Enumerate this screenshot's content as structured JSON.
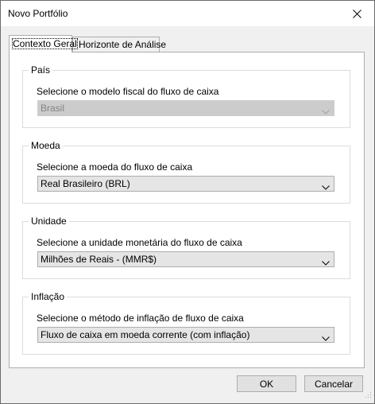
{
  "window": {
    "title": "Novo Portfólio",
    "close_icon": "close-icon"
  },
  "tabs": [
    {
      "label": "Contexto Geral",
      "active": true
    },
    {
      "label": "Horizonte de Análise",
      "active": false
    }
  ],
  "groups": {
    "pais": {
      "label": "País",
      "description": "Selecione o modelo fiscal do fluxo de caixa",
      "value": "Brasil",
      "enabled": false
    },
    "moeda": {
      "label": "Moeda",
      "description": "Selecione a moeda do fluxo de caixa",
      "value": "Real Brasileiro (BRL)",
      "enabled": true
    },
    "unidade": {
      "label": "Unidade",
      "description": "Selecione a unidade monetária do fluxo de caixa",
      "value": "Milhões de Reais - (MMR$)",
      "enabled": true
    },
    "inflacao": {
      "label": "Inflação",
      "description": "Selecione o método de inflação de fluxo de caixa",
      "value": "Fluxo de caixa em moeda corrente (com inflação)",
      "enabled": true
    }
  },
  "buttons": {
    "ok": "OK",
    "cancel": "Cancelar"
  },
  "colors": {
    "window_bg": "#f0f0f0",
    "panel_bg": "#ffffff",
    "combo_bg": "#e5e5e5",
    "disabled_text": "#838383"
  }
}
